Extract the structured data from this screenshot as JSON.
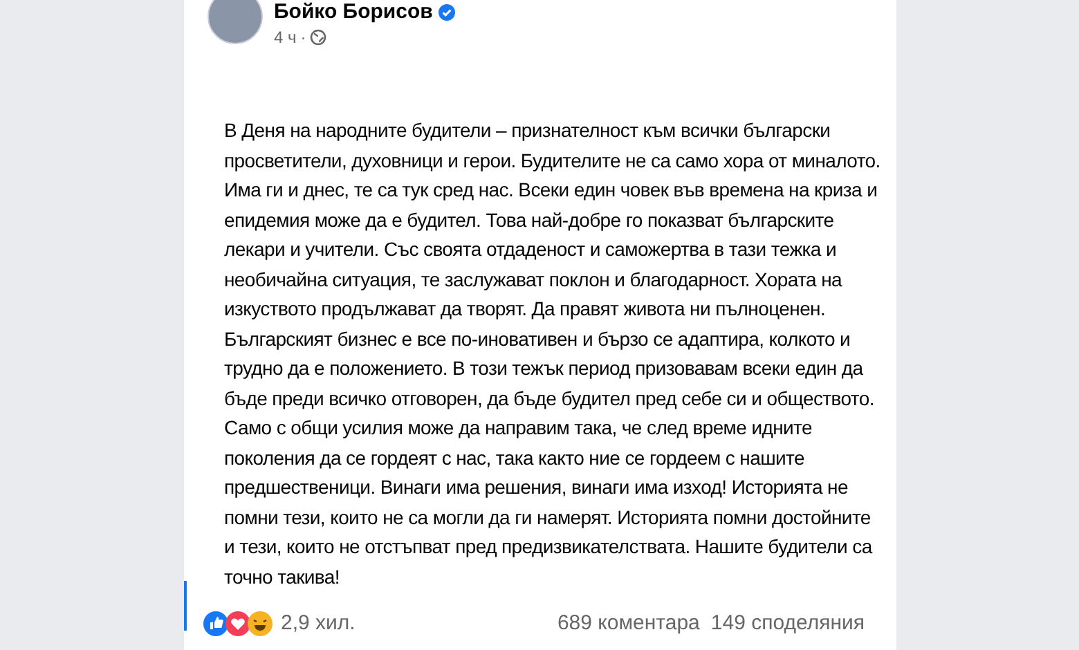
{
  "post": {
    "author": "Бойко Борисов",
    "verified": true,
    "time": "4 ч",
    "separator": "·",
    "text": "В Деня на народните будители – признателност към всички български просветители, духовници и герои. Будителите не са само хора от миналото. Има ги и днес, те са тук сред нас. Всеки един човек във времена на криза и епидемия може да е будител. Това най-добре го показват българските лекари и учители. Със своята отдаденост и саможертва в тази тежка и необичайна ситуация, те заслужават поклон и благодарност. Хората на изкуството продължават да творят. Да правят живота ни пълноценен. Българският бизнес е все по-иновативен и бързо се адаптира, колкото и трудно да е положението. В този тежък период призовавам всеки един да бъде преди всичко отговорен, да бъде будител пред себе си и обществото. Само с общи усилия може да направим така, че след време идните поколения да се гордеят с нас, така както ние се гордеем с нашите предшественици. Винаги има решения, винаги има изход! Историята не помни тези, които не са могли да ги намерят. Историята помни достойните и тези, които не отстъпват пред предизвикателствата. Нашите будители са точно такива!",
    "reactions_count": "2,9 хил.",
    "comments": "689 коментара",
    "shares": "149 споделяния"
  }
}
